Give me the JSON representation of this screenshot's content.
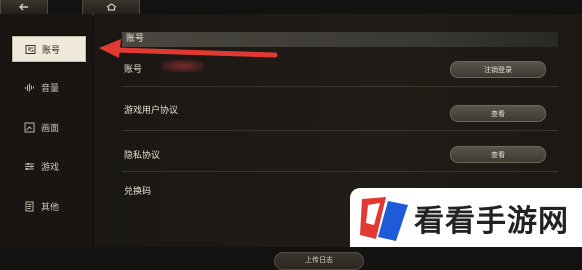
{
  "top_bar": {
    "back_icon": "back-arrow-icon",
    "home_icon": "home-icon"
  },
  "sidebar": {
    "items": [
      {
        "label": "账号",
        "icon": "account-icon",
        "active": true
      },
      {
        "label": "音量",
        "icon": "volume-icon",
        "active": false
      },
      {
        "label": "画面",
        "icon": "display-icon",
        "active": false
      },
      {
        "label": "游戏",
        "icon": "game-sliders-icon",
        "active": false
      },
      {
        "label": "其他",
        "icon": "document-icon",
        "active": false
      }
    ]
  },
  "main": {
    "section_title": "账号",
    "rows": [
      {
        "label": "账号",
        "button": "注销登录"
      },
      {
        "label": "游戏用户协议",
        "button": "查看"
      },
      {
        "label": "隐私协议",
        "button": "查看"
      },
      {
        "label": "兑换码",
        "button": ""
      }
    ],
    "upload_button": "上传日志"
  },
  "watermark": {
    "text": "看看手游网"
  },
  "colors": {
    "accent": "#e23a33",
    "highlight": "#efe9dc"
  }
}
